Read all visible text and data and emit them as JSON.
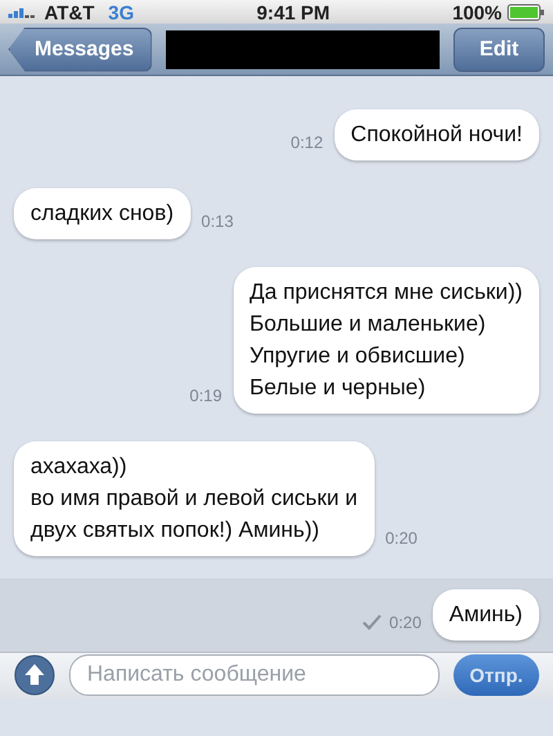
{
  "status_bar": {
    "carrier": "AT&T",
    "network": "3G",
    "time": "9:41 PM",
    "battery": "100%"
  },
  "nav": {
    "back": "Messages",
    "edit": "Edit"
  },
  "messages": [
    {
      "kind": "sent",
      "lines": [
        "Спокойной ночи!"
      ],
      "time": "0:12",
      "highlighted": false
    },
    {
      "kind": "received",
      "lines": [
        "сладких снов)"
      ],
      "time": "0:13",
      "highlighted": false
    },
    {
      "kind": "sent",
      "lines": [
        "Да приснятся мне сиськи))",
        "Большие и маленькие)",
        "Упругие и обвисшие)",
        "Белые и черные)"
      ],
      "time": "0:19",
      "highlighted": false
    },
    {
      "kind": "received",
      "lines": [
        "ахахаха))",
        "во имя правой и левой сиськи и",
        "двух святых попок!) Аминь))"
      ],
      "time": "0:20",
      "highlighted": false
    },
    {
      "kind": "sent",
      "lines": [
        "Аминь)"
      ],
      "time": "0:20",
      "delivered": true,
      "highlighted": true
    }
  ],
  "composer": {
    "placeholder": "Написать сообщение",
    "send": "Отпр."
  }
}
